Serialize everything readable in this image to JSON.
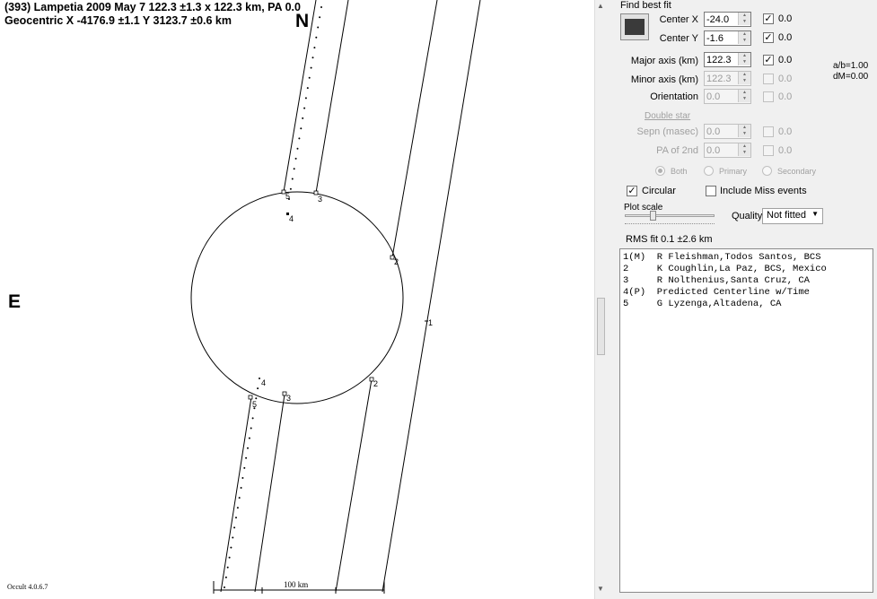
{
  "plot": {
    "header_line1": "(393) Lampetia  2009 May 7   122.3 ±1.3 x 122.3 km,  PA 0.0",
    "header_line2": "Geocentric  X  -4176.9 ±1.1  Y 3123.7 ±0.6 km",
    "north_label": "N",
    "east_label": "E",
    "chord_labels": {
      "c1": "1",
      "c2_top": "2",
      "c2_bottom": "2",
      "c3_top": "3",
      "c3_bottom": "3",
      "c4_top": "4",
      "c4_bottom": "4",
      "c5_top": "5",
      "c5_bottom": "5"
    },
    "scale_label": "100 km",
    "version": "Occult 4.0.6.7"
  },
  "panel": {
    "find_best_fit_label": "Find best fit",
    "center_x": {
      "label": "Center X",
      "value": "-24.0",
      "checked": true,
      "delta": "0.0"
    },
    "center_y": {
      "label": "Center Y",
      "value": "-1.6",
      "checked": true,
      "delta": "0.0"
    },
    "major_axis": {
      "label": "Major axis (km)",
      "value": "122.3",
      "checked": true,
      "delta": "0.0"
    },
    "minor_axis": {
      "label": "Minor axis (km)",
      "value": "122.3",
      "checked": false,
      "delta": "0.0"
    },
    "orientation": {
      "label": "Orientation",
      "value": "0.0",
      "checked": false,
      "delta": "0.0"
    },
    "ratio_ab": "a/b=1.00",
    "dm": "dM=0.00",
    "double_star_label": "Double star",
    "sepn": {
      "label": "Sepn (masec)",
      "value": "0.0",
      "checked": false,
      "delta": "0.0"
    },
    "pa2": {
      "label": "PA of 2nd",
      "value": "0.0",
      "checked": false,
      "delta": "0.0"
    },
    "radios": {
      "both": "Both",
      "primary": "Primary",
      "secondary": "Secondary"
    },
    "circular": {
      "label": "Circular",
      "checked": true
    },
    "include_miss": {
      "label": "Include Miss events",
      "checked": false
    },
    "plot_scale_label": "Plot scale",
    "plot_scale_level": 0.3,
    "quality_label": "Quality",
    "quality_value": "Not fitted",
    "rms_fit": "RMS fit 0.1 ±2.6 km",
    "observers": [
      "1(M)  R Fleishman,Todos Santos, BCS",
      "2     K Coughlin,La Paz, BCS, Mexico",
      "3     R Nolthenius,Santa Cruz, CA",
      "4(P)  Predicted Centerline w/Time",
      "5     G Lyzenga,Altadena, CA"
    ]
  },
  "check_mark": "✓"
}
